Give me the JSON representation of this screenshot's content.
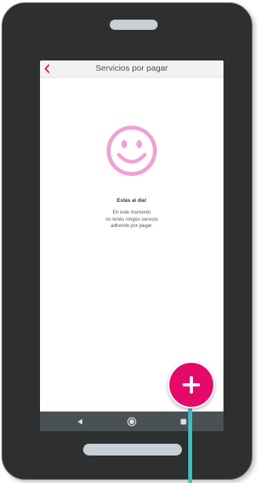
{
  "colors": {
    "accent": "#e5096a",
    "smiley": "#f0a0d4",
    "connector": "#3ec1c4",
    "device": "#2e2f2f",
    "navbar": "#4a5154"
  },
  "appbar": {
    "back_icon": "chevron-left-icon",
    "title": "Servicios por pagar"
  },
  "empty_state": {
    "icon": "smiley-icon",
    "title": "Estás al día!",
    "body_lines": [
      "En este momento",
      "no tenés ningún servicio",
      "adherido por pagar."
    ]
  },
  "navbar": {
    "buttons": [
      "back-triangle-icon",
      "home-circle-icon",
      "recents-square-icon"
    ]
  },
  "fab": {
    "icon": "plus-icon"
  }
}
